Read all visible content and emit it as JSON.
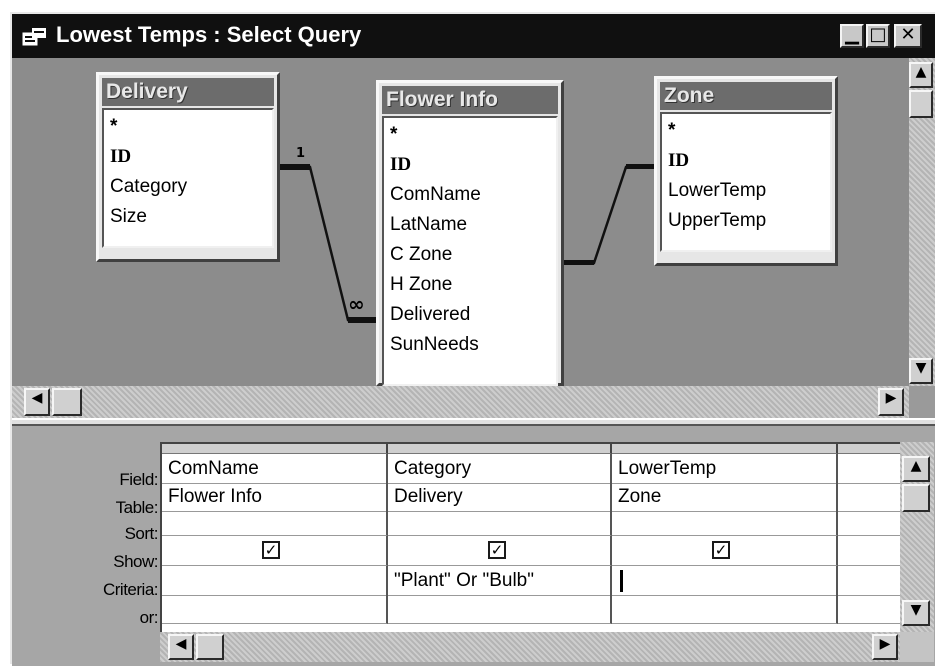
{
  "window": {
    "title": "Lowest Temps : Select Query",
    "controls": {
      "minimize": "▁",
      "maximize": "□",
      "close": "✕"
    }
  },
  "tables": [
    {
      "name": "Delivery",
      "fields": [
        "*",
        "ID",
        "Category",
        "Size"
      ]
    },
    {
      "name": "Flower Info",
      "fields": [
        "*",
        "ID",
        "ComName",
        "LatName",
        "C Zone",
        "H Zone",
        "Delivered",
        "SunNeeds"
      ]
    },
    {
      "name": "Zone",
      "fields": [
        "*",
        "ID",
        "LowerTemp",
        "UpperTemp"
      ]
    }
  ],
  "relationships": [
    {
      "from": "Delivery",
      "to": "Flower Info",
      "one_label": "1",
      "many_label": "∞"
    },
    {
      "from": "Flower Info",
      "to": "Zone"
    }
  ],
  "grid": {
    "row_labels": [
      "Field:",
      "Table:",
      "Sort:",
      "Show:",
      "Criteria:",
      "or:"
    ],
    "columns": [
      {
        "field": "ComName",
        "table": "Flower Info",
        "sort": "",
        "show": true,
        "criteria": "",
        "or": ""
      },
      {
        "field": "Category",
        "table": "Delivery",
        "sort": "",
        "show": true,
        "criteria": "\"Plant\" Or \"Bulb\"",
        "or": ""
      },
      {
        "field": "LowerTemp",
        "table": "Zone",
        "sort": "",
        "show": true,
        "criteria": "",
        "or": ""
      }
    ],
    "check_glyph": "✓"
  },
  "scroll_arrows": {
    "up": "▲",
    "down": "▼",
    "left": "◀",
    "right": "▶"
  }
}
